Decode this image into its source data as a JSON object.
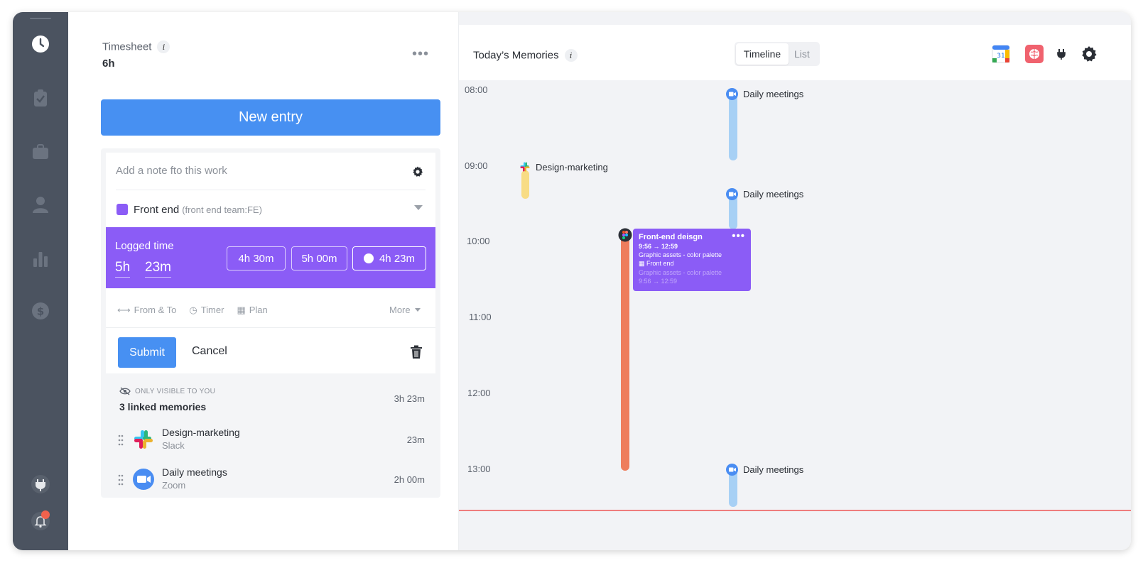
{
  "colors": {
    "sidebar": "#4b5360",
    "primary": "#4790f2",
    "project": "#8b5cf6",
    "zoom": "#4a8df2",
    "meeting_bar": "#a7d0f5",
    "slack_bar": "#f8dc85",
    "figma_bar": "#ee7d5d",
    "now_line": "#ee7d7d"
  },
  "sidebar": {
    "items": [
      {
        "icon": "clock-icon"
      },
      {
        "icon": "clipboard-check-icon"
      },
      {
        "icon": "briefcase-icon"
      },
      {
        "icon": "user-icon"
      },
      {
        "icon": "bar-chart-icon"
      },
      {
        "icon": "dollar-icon"
      },
      {
        "icon": "plug-icon"
      },
      {
        "icon": "bell-icon"
      }
    ]
  },
  "timesheet": {
    "title": "Timesheet",
    "info": "i",
    "total": "6h",
    "menu": "•••",
    "new_entry_label": "New entry"
  },
  "entry": {
    "note_placeholder": "Add a note fto this work",
    "project_name": "Front end",
    "project_team": "(front end team:FE)",
    "logged_label": "Logged time",
    "logged_hours": "5h",
    "logged_minutes": "23m",
    "chips": [
      "4h 30m",
      "5h 00m",
      "4h 23m"
    ],
    "modes": [
      {
        "symbol": "⟷",
        "label": "From & To"
      },
      {
        "symbol": "◷",
        "label": "Timer"
      },
      {
        "symbol": "▦",
        "label": "Plan"
      }
    ],
    "more_label": "More",
    "submit_label": "Submit",
    "cancel_label": "Cancel"
  },
  "memories": {
    "visibility": "ONLY VISIBLE TO YOU",
    "linked_title": "3 linked memories",
    "linked_duration": "3h 23m",
    "items": [
      {
        "title": "Design-marketing",
        "source": "Slack",
        "duration": "23m"
      },
      {
        "title": "Daily meetings",
        "source": "Zoom",
        "duration": "2h 00m"
      }
    ]
  },
  "today": {
    "title": "Today’s Memories",
    "info": "i",
    "view_active": "Timeline",
    "view_inactive": "List",
    "calendar_day": "31",
    "hours": [
      "08:00",
      "09:00",
      "10:00",
      "11:00",
      "12:00",
      "13:00"
    ],
    "events": {
      "meeting_label": "Daily meetings",
      "slack_label": "Design-marketing",
      "card_title": "Front-end deisgn",
      "card_time": "9:56 → 12:59",
      "card_desc": "Graphic assets - color palette",
      "card_project": "Front end",
      "card_faded_desc": "Graphic assets - color palette",
      "card_faded_time": "9:56 → 12:59",
      "card_menu": "•••"
    }
  }
}
